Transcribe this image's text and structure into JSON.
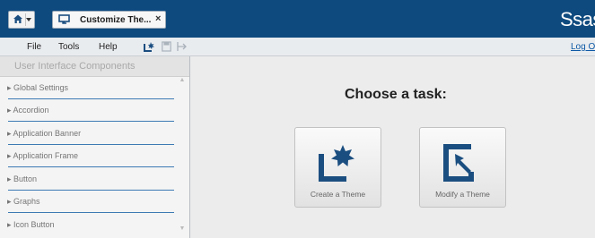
{
  "banner": {
    "tab_label": "Customize The...",
    "close_glyph": "×",
    "logo_text": "Ssas",
    "icons": [
      "home-icon",
      "chevron-down-icon",
      "tab-monitor-icon",
      "close-icon"
    ]
  },
  "menubar": {
    "items": [
      "File",
      "Tools",
      "Help"
    ],
    "toolbar_icons": [
      "new-theme-icon",
      "save-icon",
      "export-icon"
    ],
    "logoff_label": "Log O"
  },
  "sidebar": {
    "header": "User Interface Components",
    "items": [
      {
        "label": "▸ Global Settings"
      },
      {
        "label": "▸ Accordion"
      },
      {
        "label": "▸ Application Banner"
      },
      {
        "label": "▸ Application Frame"
      },
      {
        "label": "▸ Button"
      },
      {
        "label": "▸ Graphs"
      },
      {
        "label": "▸ Icon Button"
      }
    ]
  },
  "main": {
    "heading": "Choose a task:",
    "tasks": [
      {
        "label": "Create a Theme",
        "icon": "create-theme-icon"
      },
      {
        "label": "Modify a Theme",
        "icon": "modify-theme-icon"
      }
    ]
  },
  "colors": {
    "banner": "#0e4a7e",
    "icon_blue": "#1b4e80",
    "link": "#0b58a5"
  }
}
